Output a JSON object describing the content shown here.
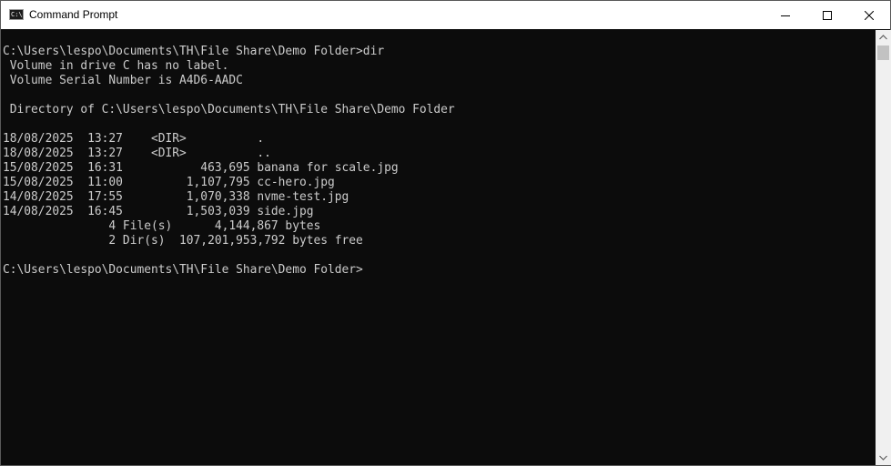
{
  "window": {
    "title": "Command Prompt",
    "app_icon_text": "C:\\",
    "icons": {
      "minimize": "minimize-icon",
      "maximize": "maximize-icon",
      "close": "close-icon"
    }
  },
  "console": {
    "lines": [
      "C:\\Users\\lespo\\Documents\\TH\\File Share\\Demo Folder>dir",
      " Volume in drive C has no label.",
      " Volume Serial Number is A4D6-AADC",
      "",
      " Directory of C:\\Users\\lespo\\Documents\\TH\\File Share\\Demo Folder",
      "",
      "18/08/2025  13:27    <DIR>          .",
      "18/08/2025  13:27    <DIR>          ..",
      "15/08/2025  16:31           463,695 banana for scale.jpg",
      "15/08/2025  11:00         1,107,795 cc-hero.jpg",
      "14/08/2025  17:55         1,070,338 nvme-test.jpg",
      "14/08/2025  16:45         1,503,039 side.jpg",
      "               4 File(s)      4,144,867 bytes",
      "               2 Dir(s)  107,201,953,792 bytes free",
      "",
      "C:\\Users\\lespo\\Documents\\TH\\File Share\\Demo Folder>"
    ]
  },
  "colors": {
    "console_bg": "#0c0c0c",
    "console_text": "#cccccc",
    "titlebar_bg": "#ffffff"
  }
}
